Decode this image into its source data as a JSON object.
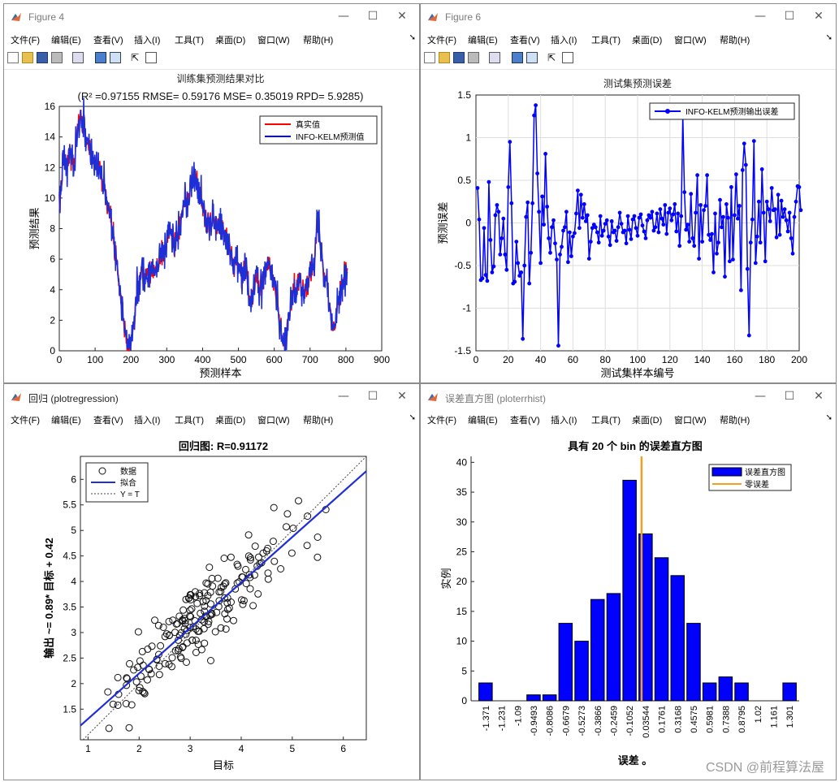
{
  "menu_items": [
    "文件(F)",
    "编辑(E)",
    "查看(V)",
    "插入(I)",
    "工具(T)",
    "桌面(D)",
    "窗口(W)",
    "帮助(H)"
  ],
  "windows": {
    "w1": {
      "title": "Figure 4"
    },
    "w2": {
      "title": "Figure 6"
    },
    "w3": {
      "title": "回归 (plotregression)"
    },
    "w4": {
      "title": "误差直方图 (ploterrhist)"
    }
  },
  "watermark": "CSDN @前程算法屋",
  "colors": {
    "red": "#ff0000",
    "blue": "#0000ff",
    "plotblue": "#1f2fd8",
    "orange": "#f0a020",
    "black": "#000000"
  },
  "chart_data": [
    {
      "id": "train",
      "type": "line",
      "title": "训练集预测结果对比",
      "subtitle": "(R² =0.97155 RMSE= 0.59176 MSE= 0.35019 RPD= 5.9285)",
      "xlabel": "预测样本",
      "ylabel": "预测结果",
      "xlim": [
        0,
        900
      ],
      "ylim": [
        0,
        16
      ],
      "xticks": [
        0,
        100,
        200,
        300,
        400,
        500,
        600,
        700,
        800,
        900
      ],
      "yticks": [
        0,
        2,
        4,
        6,
        8,
        10,
        12,
        14,
        16
      ],
      "legend": [
        "真实值",
        "INFO-KELM预测值"
      ],
      "legend_position": "top-right",
      "n_points": 805,
      "anchors": [
        [
          0,
          9
        ],
        [
          10,
          12.5
        ],
        [
          20,
          12
        ],
        [
          30,
          13
        ],
        [
          40,
          12
        ],
        [
          50,
          14
        ],
        [
          60,
          15.5
        ],
        [
          70,
          14.5
        ],
        [
          80,
          13.5
        ],
        [
          90,
          13
        ],
        [
          100,
          12
        ],
        [
          110,
          12.5
        ],
        [
          120,
          11
        ],
        [
          130,
          10.5
        ],
        [
          140,
          9
        ],
        [
          150,
          7.5
        ],
        [
          160,
          6
        ],
        [
          170,
          4
        ],
        [
          180,
          2
        ],
        [
          190,
          0.3
        ],
        [
          200,
          0.8
        ],
        [
          210,
          2
        ],
        [
          220,
          4.5
        ],
        [
          230,
          5.5
        ],
        [
          240,
          4.8
        ],
        [
          250,
          5.5
        ],
        [
          260,
          5
        ],
        [
          270,
          5.3
        ],
        [
          280,
          6
        ],
        [
          290,
          6.5
        ],
        [
          300,
          7
        ],
        [
          310,
          8
        ],
        [
          320,
          7
        ],
        [
          330,
          7.5
        ],
        [
          340,
          8.5
        ],
        [
          350,
          9.5
        ],
        [
          360,
          10
        ],
        [
          370,
          11
        ],
        [
          380,
          11.5
        ],
        [
          390,
          10.5
        ],
        [
          400,
          9.5
        ],
        [
          410,
          8.5
        ],
        [
          420,
          8
        ],
        [
          430,
          9
        ],
        [
          440,
          8
        ],
        [
          450,
          8.5
        ],
        [
          460,
          8
        ],
        [
          470,
          7
        ],
        [
          480,
          6.5
        ],
        [
          490,
          5.5
        ],
        [
          500,
          6
        ],
        [
          510,
          4.5
        ],
        [
          520,
          5.5
        ],
        [
          530,
          3.5
        ],
        [
          540,
          3.5
        ],
        [
          550,
          5
        ],
        [
          560,
          4
        ],
        [
          570,
          5
        ],
        [
          580,
          5.5
        ],
        [
          590,
          5.5
        ],
        [
          600,
          4.5
        ],
        [
          610,
          3
        ],
        [
          620,
          1
        ],
        [
          625,
          0.3
        ],
        [
          630,
          0.5
        ],
        [
          640,
          2
        ],
        [
          650,
          3.5
        ],
        [
          660,
          4
        ],
        [
          670,
          5
        ],
        [
          680,
          3.5
        ],
        [
          690,
          4
        ],
        [
          700,
          5
        ],
        [
          710,
          6
        ],
        [
          720,
          8.5
        ],
        [
          730,
          7
        ],
        [
          740,
          5
        ],
        [
          750,
          4
        ],
        [
          760,
          2
        ],
        [
          765,
          1.5
        ],
        [
          770,
          1.8
        ],
        [
          780,
          3
        ],
        [
          790,
          4.5
        ],
        [
          800,
          5.2
        ],
        [
          805,
          5.4
        ]
      ]
    },
    {
      "id": "test-error",
      "type": "line",
      "title": "测试集预测误差",
      "xlabel": "测试集样本编号",
      "ylabel": "预测误差",
      "xlim": [
        0,
        200
      ],
      "ylim": [
        -1.5,
        1.5
      ],
      "xticks": [
        0,
        20,
        40,
        60,
        80,
        100,
        120,
        140,
        160,
        180,
        200
      ],
      "yticks": [
        -1.5,
        -1,
        -0.5,
        0,
        0.5,
        1,
        1.5
      ],
      "legend": [
        "INFO-KELM预测输出误差"
      ],
      "legend_position": "top-right",
      "n_points": 200,
      "grid": true,
      "y": [
        0.41,
        0.04,
        -0.67,
        -0.65,
        -0.06,
        -0.61,
        -0.68,
        0.48,
        -0.2,
        -0.58,
        -0.51,
        0.09,
        0.21,
        0.13,
        -0.37,
        -0.18,
        0.05,
        -0.37,
        -0.55,
        0.42,
        0.95,
        0.23,
        -0.71,
        -0.69,
        -0.22,
        -0.47,
        -0.62,
        -0.58,
        -1.36,
        -0.5,
        0.07,
        0.24,
        -0.71,
        -0.35,
        0.23,
        1.26,
        1.38,
        0.58,
        0.13,
        -0.47,
        0.31,
        -0.02,
        0.81,
        0.19,
        -0.18,
        -0.35,
        -0.05,
        0.03,
        -0.24,
        -0.43,
        -1.44,
        -0.37,
        -0.28,
        -0.09,
        -0.05,
        0.13,
        -0.46,
        -0.11,
        -0.39,
        -0.16,
        -0.12,
        0.11,
        0.38,
        -0.06,
        0.33,
        0.06,
        0.22,
        0.02,
        0.09,
        -0.42,
        -0.22,
        -0.06,
        -0.02,
        -0.05,
        -0.11,
        -0.23,
        0.08,
        -0.15,
        -0.09,
        -0.01,
        0.03,
        -0.16,
        -0.26,
        0.02,
        -0.11,
        -0.09,
        -0.21,
        -0.05,
        0.12,
        -0.01,
        -0.11,
        -0.09,
        -0.24,
        0.08,
        -0.08,
        -0.19,
        0.04,
        0.08,
        -0.06,
        -0.15,
        0.06,
        0.1,
        -0.03,
        -0.1,
        -0.18,
        0.03,
        0.09,
        0.06,
        0.13,
        -0.09,
        -0.05,
        0.11,
        -0.11,
        0.16,
        0.05,
        -0.02,
        0.21,
        -0.13,
        0.12,
        0.17,
        0.03,
        0.1,
        0.22,
        -0.1,
        0.11,
        -0.27,
        0.08,
        1.26,
        0.36,
        -0.08,
        -0.02,
        -0.22,
        0.34,
        -0.18,
        -0.27,
        0.12,
        0.56,
        -0.42,
        0.21,
        -0.22,
        0.15,
        0.2,
        0.56,
        -0.14,
        -0.2,
        -0.13,
        -0.58,
        0.11,
        -0.36,
        -0.23,
        0.27,
        -0.05,
        0.07,
        -0.63,
        0.22,
        0.06,
        -0.45,
        0.42,
        -0.43,
        0.09,
        0.57,
        0.05,
        0.2,
        -0.79,
        0.62,
        0.93,
        0.68,
        -0.54,
        -1.32,
        -0.23,
        0.04,
        0.96,
        -0.47,
        -0.16,
        0.25,
        -0.23,
        0.63,
        0.12,
        -0.45,
        0.25,
        0.16,
        0.02,
        0.41,
        0.15,
        0.16,
        -0.17,
        0.33,
        -0.14,
        0.26,
        0.07,
        0.16,
        0.03,
        -0.1,
        0.12,
        -0.18,
        -0.36,
        0.07,
        0.25,
        0.43,
        0.42,
        0.15
      ]
    },
    {
      "id": "regression",
      "type": "scatter",
      "title": "回归图: R=0.91172",
      "xlabel": "目标",
      "ylabel": "输出 ~= 0.89* 目标 + 0.42",
      "xlim": [
        0.85,
        6.45
      ],
      "ylim": [
        0.9,
        6.45
      ],
      "xticks": [
        1,
        2,
        3,
        4,
        5,
        6
      ],
      "yticks": [
        1.5,
        2,
        2.5,
        3,
        3.5,
        4,
        4.5,
        5,
        5.5,
        6
      ],
      "legend": [
        "数据",
        "拟合",
        "Y = T"
      ],
      "legend_position": "top-left",
      "fit": {
        "slope": 0.89,
        "intercept": 0.42
      },
      "n_points": 200
    },
    {
      "id": "error-hist",
      "type": "bar",
      "title": "具有 20 个 bin 的误差直方图",
      "xlabel": "误差 。",
      "ylabel": "实例",
      "ylim": [
        0,
        41
      ],
      "yticks": [
        0,
        5,
        10,
        15,
        20,
        25,
        30,
        35,
        40
      ],
      "categories": [
        "-1.371",
        "-1.231",
        "-1.09",
        "-0.9493",
        "-0.8086",
        "-0.6679",
        "-0.5273",
        "-0.3866",
        "-0.2459",
        "-0.1052",
        "0.03544",
        "0.1761",
        "0.3168",
        "0.4575",
        "0.5981",
        "0.7388",
        "0.8795",
        "1.02",
        "1.161",
        "1.301"
      ],
      "values": [
        3,
        0,
        0,
        1,
        1,
        13,
        10,
        17,
        18,
        37,
        28,
        24,
        21,
        13,
        3,
        4,
        3,
        0,
        0,
        3
      ],
      "zero_line_x": 0,
      "legend": [
        "误差直方图",
        "零误差"
      ],
      "legend_position": "top-right"
    }
  ]
}
